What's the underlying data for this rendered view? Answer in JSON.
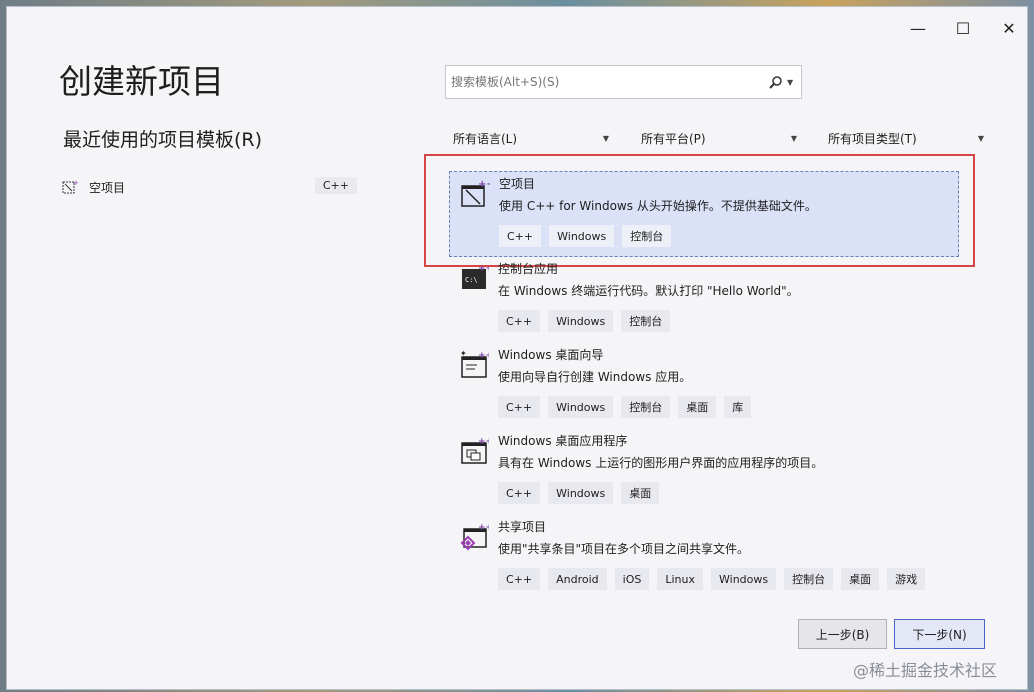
{
  "window": {
    "title": "创建新项目",
    "controls": {
      "minimize": "—",
      "maximize": "☐",
      "close": "✕"
    }
  },
  "recent": {
    "title": "最近使用的项目模板(R)",
    "items": [
      {
        "label": "空项目",
        "tag": "C++",
        "icon": "empty-project-icon"
      }
    ]
  },
  "search": {
    "placeholder": "搜索模板(Alt+S)(S)",
    "value": ""
  },
  "filters": {
    "language": "所有语言(L)",
    "platform": "所有平台(P)",
    "project_type": "所有项目类型(T)"
  },
  "templates": [
    {
      "name": "空项目",
      "desc": "使用 C++ for Windows 从头开始操作。不提供基础文件。",
      "tags": [
        "C++",
        "Windows",
        "控制台"
      ],
      "icon": "empty-project-icon",
      "selected": true
    },
    {
      "name": "控制台应用",
      "desc": "在 Windows 终端运行代码。默认打印 \"Hello World\"。",
      "tags": [
        "C++",
        "Windows",
        "控制台"
      ],
      "icon": "console-app-icon"
    },
    {
      "name": "Windows 桌面向导",
      "desc": "使用向导自行创建 Windows 应用。",
      "tags": [
        "C++",
        "Windows",
        "控制台",
        "桌面",
        "库"
      ],
      "icon": "desktop-wizard-icon"
    },
    {
      "name": "Windows 桌面应用程序",
      "desc": "具有在 Windows 上运行的图形用户界面的应用程序的项目。",
      "tags": [
        "C++",
        "Windows",
        "桌面"
      ],
      "icon": "desktop-app-icon"
    },
    {
      "name": "共享项目",
      "desc": "使用\"共享条目\"项目在多个项目之间共享文件。",
      "tags": [
        "C++",
        "Android",
        "iOS",
        "Linux",
        "Windows",
        "控制台",
        "桌面",
        "游戏"
      ],
      "icon": "shared-project-icon"
    }
  ],
  "buttons": {
    "back": "上一步(B)",
    "next": "下一步(N)"
  },
  "watermark": "@稀土掘金技术社区",
  "colors": {
    "selection_bg": "#dbe1f7",
    "highlight_border": "#d64545",
    "primary_border": "#4a63c8"
  }
}
